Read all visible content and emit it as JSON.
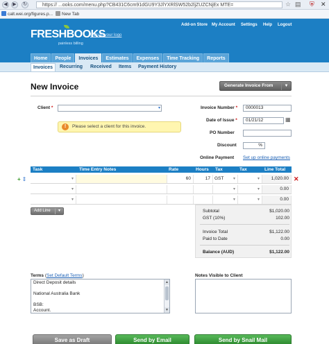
{
  "browser": {
    "url": "https://  ...ooks.com/menu.php?CB431C6cm91dGU9Y3JlYXRlSW52b2ljZUZCNjEx MTE=",
    "bookmarks": [
      "calt.wei.org/figures.p...",
      "New Tab"
    ]
  },
  "header": {
    "logo": "FRESHBOOKS",
    "tagline": "painless billing",
    "upload_logo": "Upload your logo",
    "top_links": [
      "Add-on Store",
      "My Account",
      "Settings",
      "Help",
      "Logout"
    ],
    "tabs": [
      "Home",
      "People",
      "Invoices",
      "Estimates",
      "Expenses",
      "Time Tracking",
      "Reports"
    ]
  },
  "subnav": [
    "Invoices",
    "Recurring",
    "Received",
    "Items",
    "Payment History"
  ],
  "page": {
    "title": "New Invoice",
    "generate_button": "Generate Invoice From"
  },
  "form": {
    "client_label": "Client",
    "client_value": "",
    "client_warning": "Please select a client for this invoice.",
    "invoice_number_label": "Invoice Number",
    "invoice_number": "0000013",
    "date_label": "Date of Issue",
    "date": "01/21/12",
    "po_label": "PO Number",
    "po": "",
    "discount_label": "Discount",
    "discount_unit": "%",
    "online_payment_label": "Online Payment",
    "online_payment_link": "Set up online payments"
  },
  "table": {
    "headers": [
      "Task",
      "Time Entry Notes",
      "Rate",
      "Hours",
      "Tax",
      "Tax",
      "Line Total"
    ],
    "rows": [
      {
        "task": "",
        "notes": "",
        "rate": "60",
        "hours": "17",
        "tax1": "GST",
        "tax2": "",
        "total": "1,020.00"
      },
      {
        "task": "",
        "notes": "",
        "rate": "",
        "hours": "",
        "tax1": "",
        "tax2": "",
        "total": "0.00"
      },
      {
        "task": "",
        "notes": "",
        "rate": "",
        "hours": "",
        "tax1": "",
        "tax2": "",
        "total": "0.00"
      }
    ],
    "add_line": "Add Line"
  },
  "totals": {
    "subtotal_label": "Subtotal",
    "subtotal": "$1,020.00",
    "tax_label": "GST (10%)",
    "tax": "102.00",
    "invoice_total_label": "Invoice Total",
    "invoice_total": "$1,122.00",
    "paid_label": "Paid to Date",
    "paid": "0.00",
    "balance_label": "Balance (AUD)",
    "balance": "$1,122.00"
  },
  "terms": {
    "label": "Terms",
    "default_link": "Set Default Terms",
    "lines": [
      "Direct Deposit details",
      "",
      "National Australia Bank",
      "",
      "BSB:",
      "Account."
    ]
  },
  "notes": {
    "label": "Notes Visible to Client"
  },
  "footer": {
    "draft": "Save as Draft",
    "email": "Send by Email",
    "snail": "Send by Snail Mail"
  }
}
